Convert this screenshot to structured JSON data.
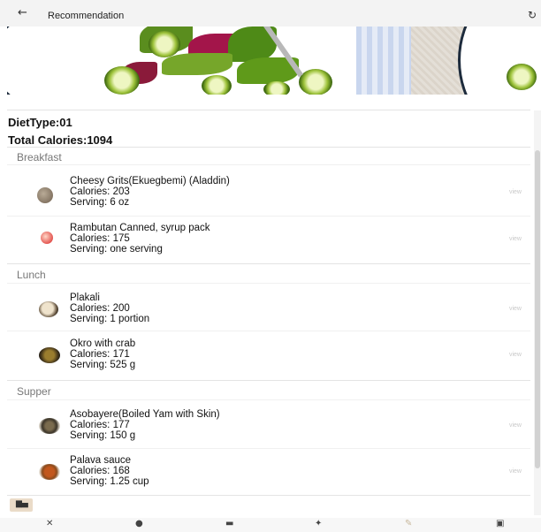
{
  "header": {
    "back_icon": "arrow-left-icon",
    "title": "Recommendation",
    "refresh_icon": "refresh-icon"
  },
  "summary": {
    "diet_type": "DietType:01",
    "total_calories": "Total Calories:1094"
  },
  "sections": [
    {
      "label": "Breakfast",
      "items": [
        {
          "name": "Cheesy Grits(Ekuegbemi) (Aladdin)",
          "calories": "Calories: 203",
          "serving": "Serving: 6 oz",
          "action": "view"
        },
        {
          "name": "Rambutan Canned, syrup pack",
          "calories": "Calories: 175",
          "serving": "Serving: one serving",
          "action": "view"
        }
      ]
    },
    {
      "label": "Lunch",
      "items": [
        {
          "name": "Plakali",
          "calories": "Calories: 200",
          "serving": "Serving: 1 portion",
          "action": "view"
        },
        {
          "name": "Okro with crab",
          "calories": "Calories: 171",
          "serving": "Serving: 525 g",
          "action": "view"
        }
      ]
    },
    {
      "label": "Supper",
      "items": [
        {
          "name": "Asobayere(Boiled Yam with Skin)",
          "calories": "Calories: 177",
          "serving": "Serving: 150 g",
          "action": "view"
        },
        {
          "name": "Palava sauce",
          "calories": "Calories: 168",
          "serving": "Serving: 1.25 cup",
          "action": "view"
        }
      ]
    }
  ],
  "floating_button": {
    "icon": "bar-chart-icon"
  },
  "bottom_nav": [
    {
      "icon": "utensils-icon"
    },
    {
      "icon": "globe-icon"
    },
    {
      "icon": "chat-icon"
    },
    {
      "icon": "walking-icon"
    },
    {
      "icon": "pen-icon"
    },
    {
      "icon": "briefcase-icon"
    }
  ],
  "colors": {
    "background": "#ffffff",
    "header_bg": "#f3f3f3",
    "section_label": "#777777",
    "view_link": "#c9c9c9",
    "chart_button_bg": "#eadbc8"
  }
}
